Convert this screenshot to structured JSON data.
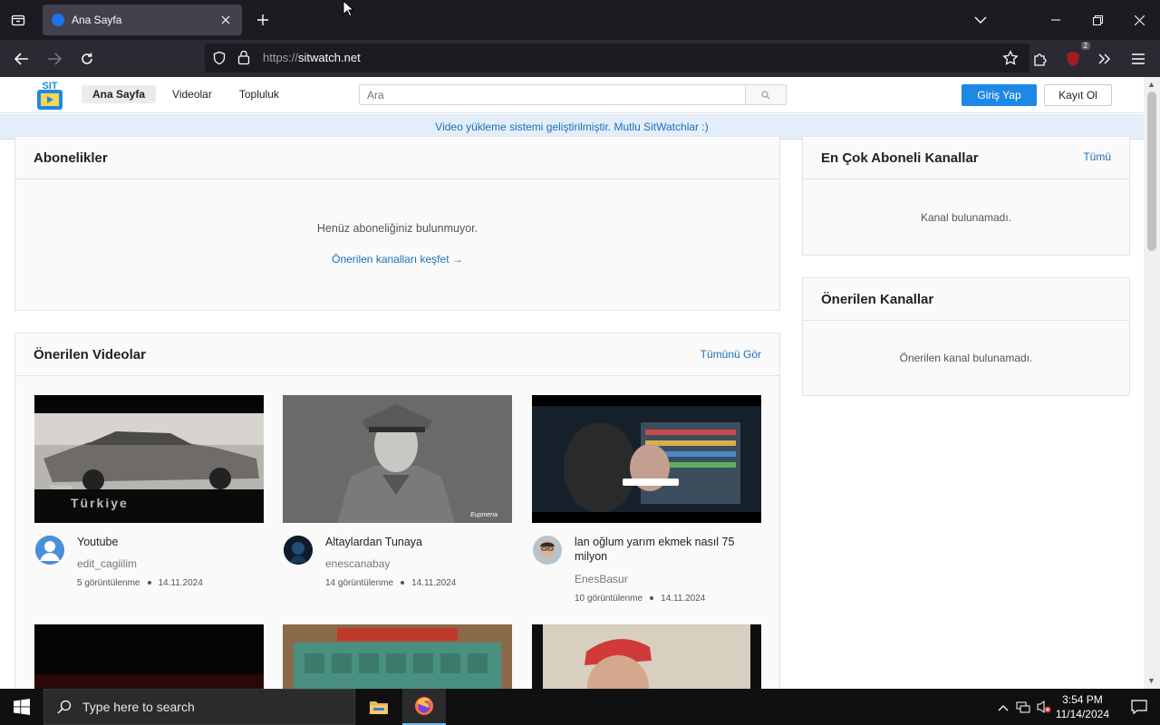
{
  "browser": {
    "tab_title": "Ana Sayfa",
    "url_scheme": "https://",
    "url_host": "sitwatch.net",
    "extension_badge": "2"
  },
  "site": {
    "nav": [
      "Ana Sayfa",
      "Videolar",
      "Topluluk"
    ],
    "search_placeholder": "Ara",
    "login": "Giriş Yap",
    "register": "Kayıt Ol",
    "announcement": "Video yükleme sistemi geliştirilmiştir. Mutlu SitWatchlar :)"
  },
  "subscriptions": {
    "title": "Abonelikler",
    "empty": "Henüz aboneliğiniz bulunmuyor.",
    "discover": "Önerilen kanalları keşfet →"
  },
  "recommended_videos": {
    "title": "Önerilen Videolar",
    "see_all": "Tümünü Gör",
    "videos": [
      {
        "title": "Youtube",
        "channel": "edit_cagiilim",
        "views": "5 görüntülenme",
        "date": "14.11.2024"
      },
      {
        "title": "Altaylardan Tunaya",
        "channel": "enescanabay",
        "views": "14 görüntülenme",
        "date": "14.11.2024"
      },
      {
        "title": "lan oğlum yarım ekmek nasıl 75 milyon",
        "channel": "EnesBasur",
        "views": "10 görüntülenme",
        "date": "14.11.2024"
      }
    ],
    "thumb_text": {
      "v1": "Türkiye",
      "v1_small": "Youtube",
      "v2": "Eupmeria"
    }
  },
  "top_channels": {
    "title": "En Çok Aboneli Kanallar",
    "all": "Tümü",
    "empty": "Kanal bulunamadı."
  },
  "suggested_channels": {
    "title": "Önerilen Kanallar",
    "empty": "Önerilen kanal bulunamadı."
  },
  "taskbar": {
    "search_placeholder": "Type here to search",
    "time": "3:54 PM",
    "date": "11/14/2024"
  }
}
